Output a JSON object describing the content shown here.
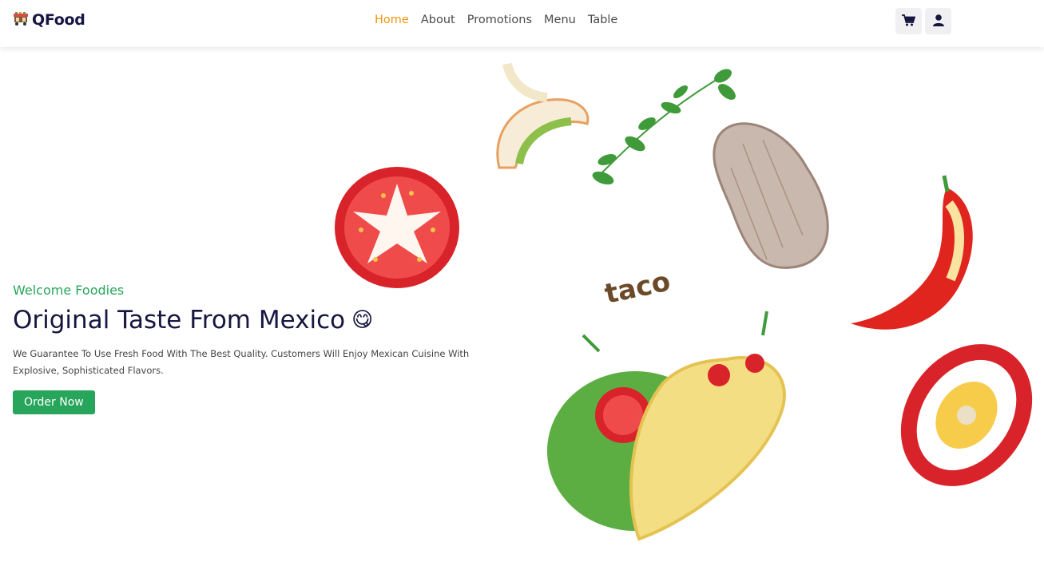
{
  "brand": {
    "name": "QFood",
    "logo_icon": "food-cart-icon"
  },
  "nav": {
    "links": [
      {
        "label": "Home",
        "active": true
      },
      {
        "label": "About",
        "active": false
      },
      {
        "label": "Promotions",
        "active": false
      },
      {
        "label": "Menu",
        "active": false
      },
      {
        "label": "Table",
        "active": false
      }
    ],
    "actions": [
      {
        "icon": "cart-icon"
      },
      {
        "icon": "user-icon"
      }
    ]
  },
  "hero": {
    "welcome": "Welcome Foodies",
    "title": "Original Taste From Mexico",
    "emoji": "😋",
    "description": "We Guarantee To Use Fresh Food With The Best Quality. Customers Will Enjoy Mexican Cuisine With Explosive, Sophisticated Flavors.",
    "cta_label": "Order Now",
    "illustration_word": "taco"
  },
  "colors": {
    "accent": "#f0960f",
    "brand_green": "#27a55b",
    "heading": "#161640"
  }
}
